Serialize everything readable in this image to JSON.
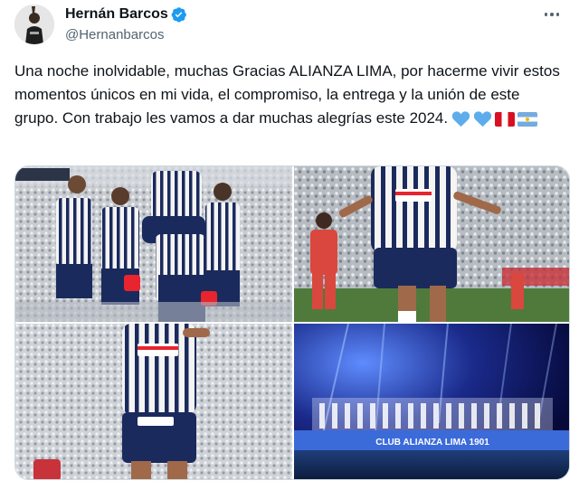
{
  "author": {
    "name": "Hernán Barcos",
    "handle": "@Hernanbarcos",
    "avatar_icon": "profile-photo-icon",
    "verified_icon": "verified-badge-icon",
    "verified_color": "#1d9bf0"
  },
  "menu": {
    "icon": "more-options-icon"
  },
  "tweet": {
    "text": "Una noche inolvidable, muchas Gracias ALIANZA LIMA, por hacerme vivir estos momentos únicos en mi vida, el compromiso, la entrega y la unión de este grupo. Con trabajo les vamos a dar muchas alegrías este 2024.",
    "emojis": [
      "blue-heart-icon",
      "blue-heart-icon",
      "peru-flag-icon",
      "argentina-flag-icon"
    ]
  },
  "media": {
    "photos": [
      {
        "name": "team-celebration-photo",
        "kit_logo": "Peoples"
      },
      {
        "name": "player-running-photo",
        "kit_logo": ""
      },
      {
        "name": "player-back-photo",
        "kit_logo": "Peoples"
      },
      {
        "name": "team-stage-photo",
        "banner": "CLUB ALIANZA LIMA 1901"
      }
    ]
  },
  "colors": {
    "text": "#0f1419",
    "secondary": "#536471",
    "accent": "#1d9bf0",
    "kit_navy": "#1b2a5c"
  }
}
